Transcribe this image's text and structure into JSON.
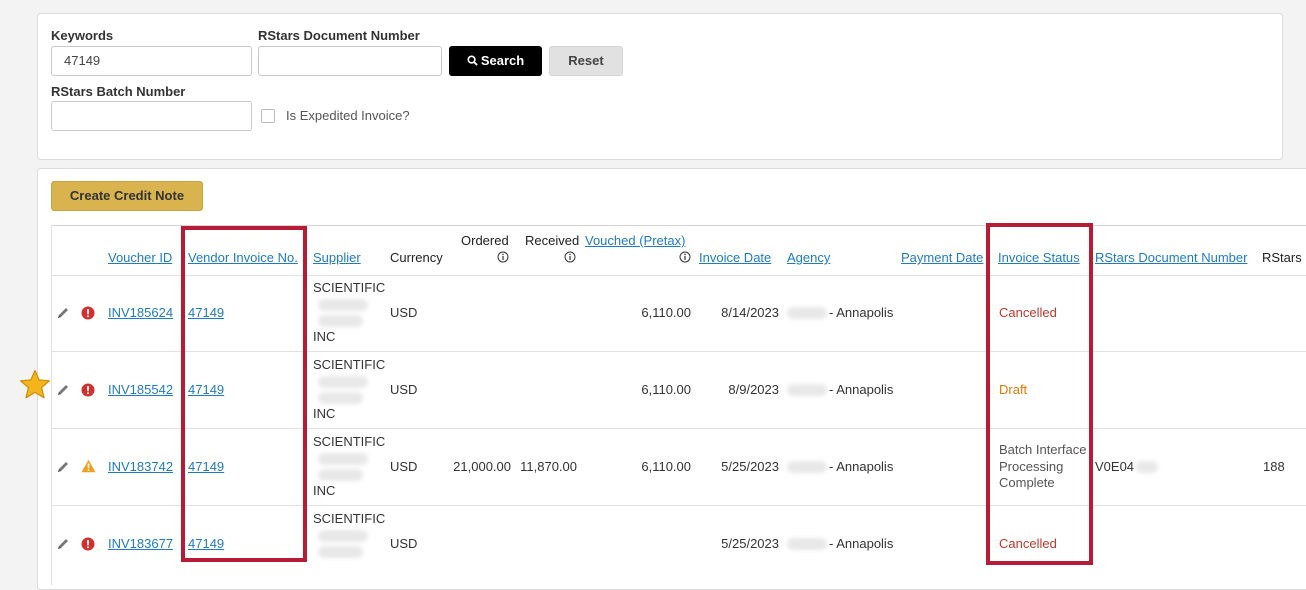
{
  "search": {
    "keywords_label": "Keywords",
    "keywords_value": "47149",
    "rstars_doc_label": "RStars Document Number",
    "rstars_doc_value": "",
    "search_button": "Search",
    "reset_button": "Reset",
    "rstars_batch_label": "RStars Batch Number",
    "rstars_batch_value": "",
    "expedited_label": "Is Expedited Invoice?"
  },
  "results": {
    "create_credit_note": "Create Credit Note",
    "headers": {
      "voucher_id": "Voucher ID",
      "vendor_invoice": "Vendor Invoice No.",
      "supplier": "Supplier",
      "currency": "Currency",
      "ordered": "Ordered",
      "received": "Received",
      "vouched": "Vouched (Pretax)",
      "invoice_date": "Invoice Date",
      "agency": "Agency",
      "payment_date": "Payment Date",
      "invoice_status": "Invoice Status",
      "rstars_doc": "RStars Document Number",
      "rstars_batch": "RStars"
    },
    "rows": [
      {
        "voucher": "INV185624",
        "vendor_invoice": "47149",
        "supplier_top": "SCIENTIFIC",
        "supplier_bottom": "INC",
        "currency": "USD",
        "ordered": "",
        "received": "",
        "vouched": "6,110.00",
        "invoice_date": "8/14/2023",
        "agency": "- Annapolis",
        "payment_date": "",
        "status": "Cancelled",
        "rstars_doc": "",
        "rstars_batch": "",
        "alert": "error"
      },
      {
        "voucher": "INV185542",
        "vendor_invoice": "47149",
        "supplier_top": "SCIENTIFIC",
        "supplier_bottom": "INC",
        "currency": "USD",
        "ordered": "",
        "received": "",
        "vouched": "6,110.00",
        "invoice_date": "8/9/2023",
        "agency": "- Annapolis",
        "payment_date": "",
        "status": "Draft",
        "rstars_doc": "",
        "rstars_batch": "",
        "alert": "error"
      },
      {
        "voucher": "INV183742",
        "vendor_invoice": "47149",
        "supplier_top": "SCIENTIFIC",
        "supplier_bottom": "INC",
        "currency": "USD",
        "ordered": "21,000.00",
        "received": "11,870.00",
        "vouched": "6,110.00",
        "invoice_date": "5/25/2023",
        "agency": "- Annapolis",
        "payment_date": "",
        "status": "Batch Interface Processing Complete",
        "rstars_doc": "V0E04",
        "rstars_batch": "188",
        "alert": "warning"
      },
      {
        "voucher": "INV183677",
        "vendor_invoice": "47149",
        "supplier_top": "SCIENTIFIC",
        "supplier_bottom": "",
        "currency": "USD",
        "ordered": "",
        "received": "",
        "vouched": "",
        "invoice_date": "5/25/2023",
        "agency": "- Annapolis",
        "payment_date": "",
        "status": "Cancelled",
        "rstars_doc": "",
        "rstars_batch": "",
        "alert": "error"
      }
    ]
  },
  "colors": {
    "link": "#1f7bc4",
    "highlight": "#b81b35",
    "cancelled": "#c0392b",
    "draft": "#e07b00",
    "credit_button": "#d8b34e",
    "error_icon": "#d32f2f",
    "warning_icon": "#f0a020",
    "star": "#f3b51b"
  }
}
